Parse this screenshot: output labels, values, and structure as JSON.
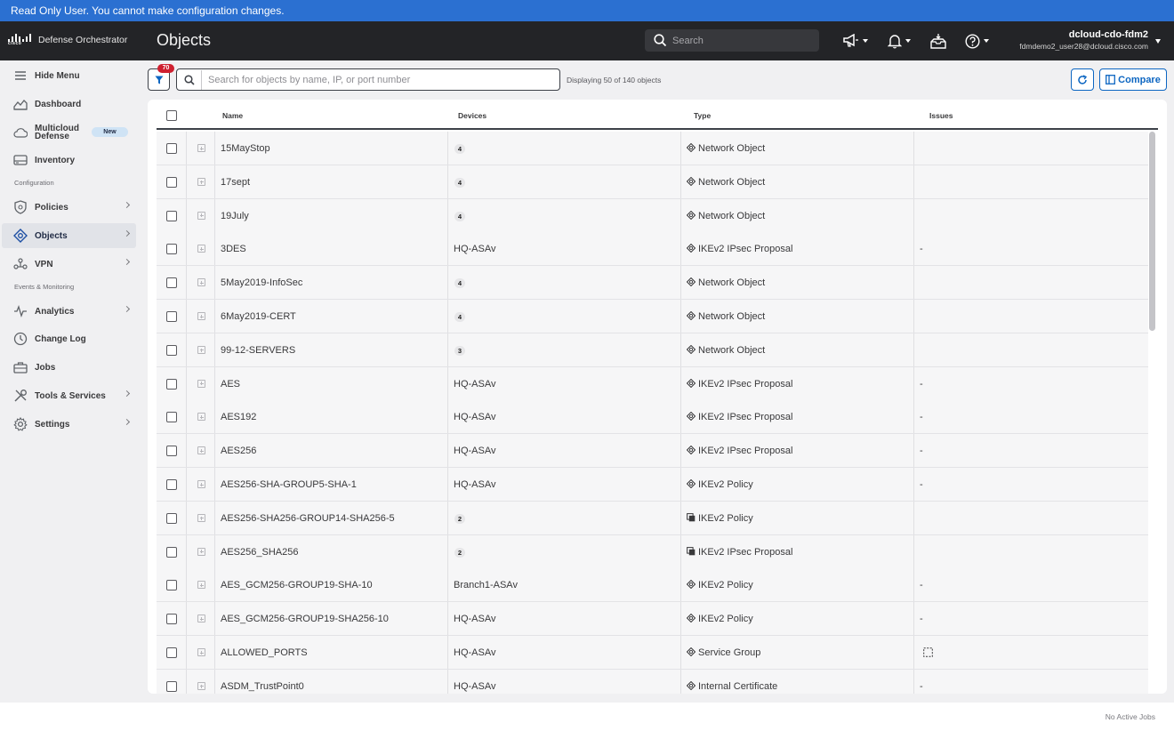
{
  "banner": {
    "text": "Read Only User. You cannot make configuration changes."
  },
  "header": {
    "brand": "Defense Orchestrator",
    "logo_text": "cisco",
    "page_title": "Objects",
    "search_placeholder": "Search",
    "user_name": "dcloud-cdo-fdm2",
    "user_email": "fdmdemo2_user28@dcloud.cisco.com"
  },
  "sidebar": {
    "hide_menu": "Hide Menu",
    "dashboard": "Dashboard",
    "multicloud": "Multicloud Defense",
    "new_badge": "New",
    "inventory": "Inventory",
    "section_configuration": "Configuration",
    "policies": "Policies",
    "objects": "Objects",
    "vpn": "VPN",
    "section_events": "Events & Monitoring",
    "analytics": "Analytics",
    "change_log": "Change Log",
    "jobs": "Jobs",
    "tools_services": "Tools & Services",
    "settings": "Settings"
  },
  "toolbar": {
    "filter_count": "70",
    "search_placeholder": "Search for objects by name, IP, or port number",
    "display_count": "Displaying 50 of 140 objects",
    "compare_label": "Compare"
  },
  "table": {
    "columns": {
      "name": "Name",
      "devices": "Devices",
      "type": "Type",
      "issues": "Issues"
    },
    "rows": [
      {
        "name": "15MayStop",
        "devices": "",
        "device_count": "4",
        "type": "Network Object",
        "type_icon": "object-icon",
        "issues": ""
      },
      {
        "name": "17sept",
        "devices": "",
        "device_count": "4",
        "type": "Network Object",
        "type_icon": "object-icon",
        "issues": ""
      },
      {
        "name": "19July",
        "devices": "",
        "device_count": "4",
        "type": "Network Object",
        "type_icon": "object-icon",
        "issues": ""
      },
      {
        "name": "3DES",
        "devices": "HQ-ASAv",
        "device_count": "",
        "type": "IKEv2 IPsec Proposal",
        "type_icon": "object-icon",
        "issues": "-"
      },
      {
        "name": "5May2019-InfoSec",
        "devices": "",
        "device_count": "4",
        "type": "Network Object",
        "type_icon": "object-icon",
        "issues": ""
      },
      {
        "name": "6May2019-CERT",
        "devices": "",
        "device_count": "4",
        "type": "Network Object",
        "type_icon": "object-icon",
        "issues": ""
      },
      {
        "name": "99-12-SERVERS",
        "devices": "",
        "device_count": "3",
        "type": "Network Object",
        "type_icon": "object-icon",
        "issues": ""
      },
      {
        "name": "AES",
        "devices": "HQ-ASAv",
        "device_count": "",
        "type": "IKEv2 IPsec Proposal",
        "type_icon": "object-icon",
        "issues": "-"
      },
      {
        "name": "AES192",
        "devices": "HQ-ASAv",
        "device_count": "",
        "type": "IKEv2 IPsec Proposal",
        "type_icon": "object-icon",
        "issues": "-"
      },
      {
        "name": "AES256",
        "devices": "HQ-ASAv",
        "device_count": "",
        "type": "IKEv2 IPsec Proposal",
        "type_icon": "object-icon",
        "issues": "-"
      },
      {
        "name": "AES256-SHA-GROUP5-SHA-1",
        "devices": "HQ-ASAv",
        "device_count": "",
        "type": "IKEv2 Policy",
        "type_icon": "object-icon",
        "issues": "-"
      },
      {
        "name": "AES256-SHA256-GROUP14-SHA256-5",
        "devices": "",
        "device_count": "2",
        "type": "IKEv2 Policy",
        "type_icon": "shared-object-icon",
        "issues": ""
      },
      {
        "name": "AES256_SHA256",
        "devices": "",
        "device_count": "2",
        "type": "IKEv2 IPsec Proposal",
        "type_icon": "shared-object-icon",
        "issues": ""
      },
      {
        "name": "AES_GCM256-GROUP19-SHA-10",
        "devices": "Branch1-ASAv",
        "device_count": "",
        "type": "IKEv2 Policy",
        "type_icon": "object-icon",
        "issues": "-"
      },
      {
        "name": "AES_GCM256-GROUP19-SHA256-10",
        "devices": "HQ-ASAv",
        "device_count": "",
        "type": "IKEv2 Policy",
        "type_icon": "object-icon",
        "issues": "-"
      },
      {
        "name": "ALLOWED_PORTS",
        "devices": "HQ-ASAv",
        "device_count": "",
        "type": "Service Group",
        "type_icon": "object-icon",
        "issues": "",
        "issue_icon": "unused-icon"
      },
      {
        "name": "ASDM_TrustPoint0",
        "devices": "HQ-ASAv",
        "device_count": "",
        "type": "Internal Certificate",
        "type_icon": "object-icon",
        "issues": "-"
      }
    ]
  },
  "footer": {
    "status": "No Active Jobs"
  },
  "colors": {
    "banner": "#2b70d1",
    "topbar": "#232427",
    "accent": "#0d66c2",
    "filter_badge": "#cf2030"
  }
}
